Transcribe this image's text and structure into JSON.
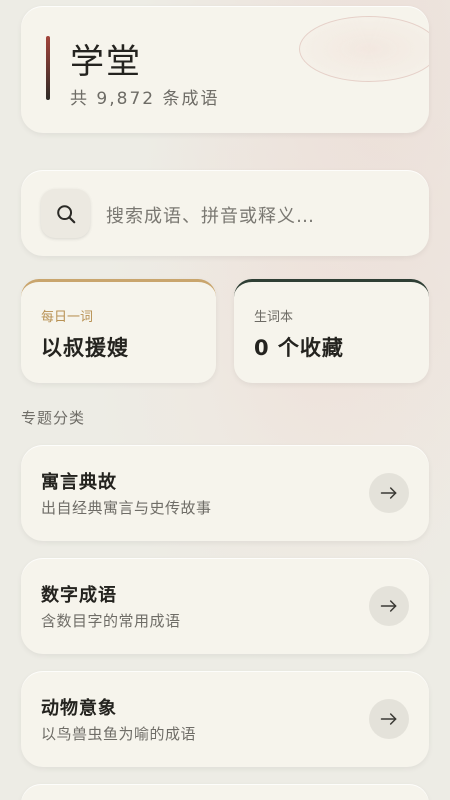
{
  "header": {
    "title": "学堂",
    "subtitle": "共 9,872 条成语"
  },
  "search": {
    "placeholder": "搜索成语、拼音或释义…",
    "icon": "search-icon"
  },
  "daily_word": {
    "label": "每日一词",
    "value": "以叔援嫂",
    "accent": "#c9a56d"
  },
  "vocab_book": {
    "label": "生词本",
    "value": "0 个收藏",
    "accent": "#2f3f35"
  },
  "section": {
    "title": "专题分类"
  },
  "topics": [
    {
      "title": "寓言典故",
      "desc": "出自经典寓言与史传故事",
      "icon": "arrow-right-icon"
    },
    {
      "title": "数字成语",
      "desc": "含数目字的常用成语",
      "icon": "arrow-right-icon"
    },
    {
      "title": "动物意象",
      "desc": "以鸟兽虫鱼为喻的成语",
      "icon": "arrow-right-icon"
    }
  ]
}
